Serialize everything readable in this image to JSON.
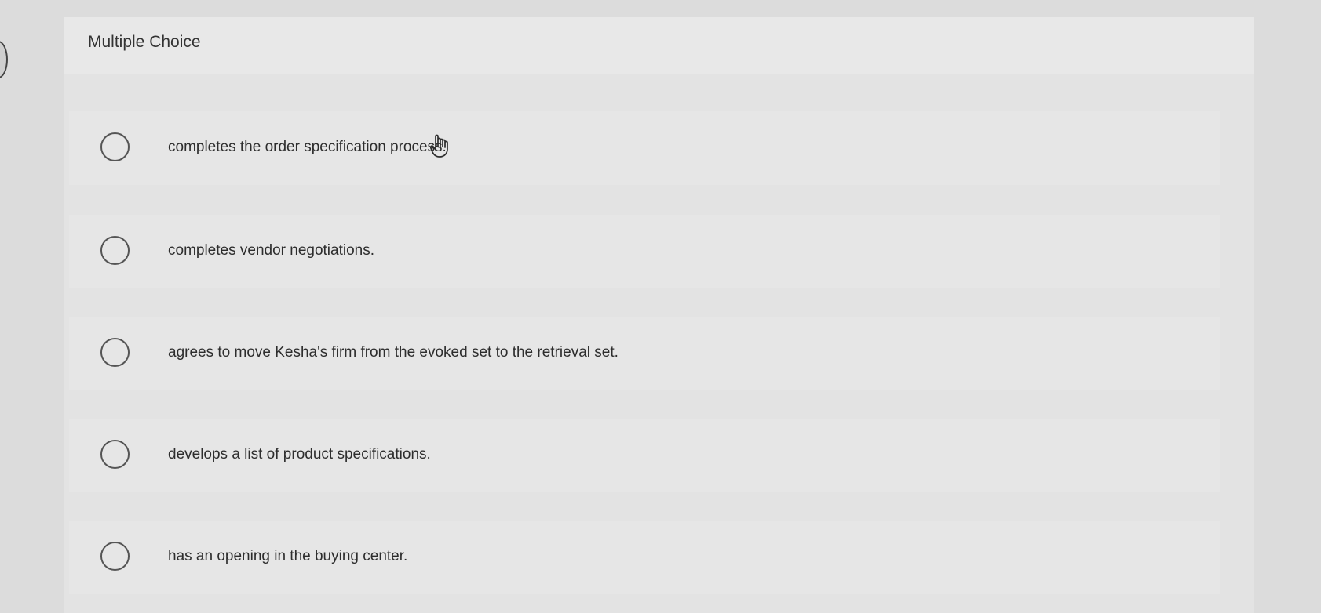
{
  "section": {
    "title": "Multiple Choice"
  },
  "choices": [
    {
      "label": "completes the order specification process."
    },
    {
      "label": "completes vendor negotiations."
    },
    {
      "label": "agrees to move Kesha's firm from the evoked set to the retrieval set."
    },
    {
      "label": "develops a list of product specifications."
    },
    {
      "label": "has an opening in the buying center."
    }
  ],
  "icons": {
    "radio": "radio-circle-icon",
    "cursor": "hand-pointer-icon"
  }
}
